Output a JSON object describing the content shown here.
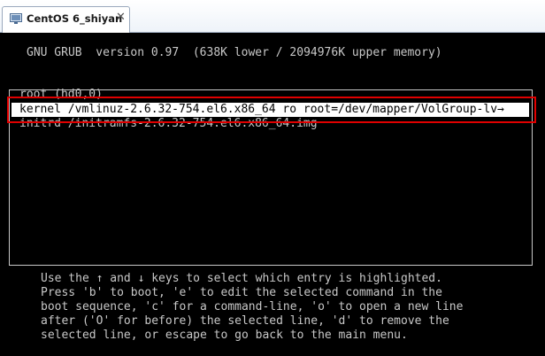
{
  "tab": {
    "title": "CentOS 6_shiyan",
    "close": "✕"
  },
  "grub": {
    "header": "GNU GRUB  version 0.97  (638K lower / 2094976K upper memory)",
    "entries": [
      "root (hd0,0)",
      "kernel /vmlinuz-2.6.32-754.el6.x86_64 ro root=/dev/mapper/VolGroup-lv→",
      "initrd /initramfs-2.6.32-754.el6.x86_64.img"
    ],
    "selected_index": 1,
    "help_lines": [
      "Use the ↑ and ↓ keys to select which entry is highlighted.",
      "Press 'b' to boot, 'e' to edit the selected command in the",
      "boot sequence, 'c' for a command-line, 'o' to open a new line",
      "after ('O' for before) the selected line, 'd' to remove the",
      "selected line, or escape to go back to the main menu."
    ]
  },
  "colors": {
    "console_bg": "#000000",
    "console_text": "#c8c8c8",
    "selection_bg": "#ffffff",
    "annotation_red": "#e00000"
  }
}
